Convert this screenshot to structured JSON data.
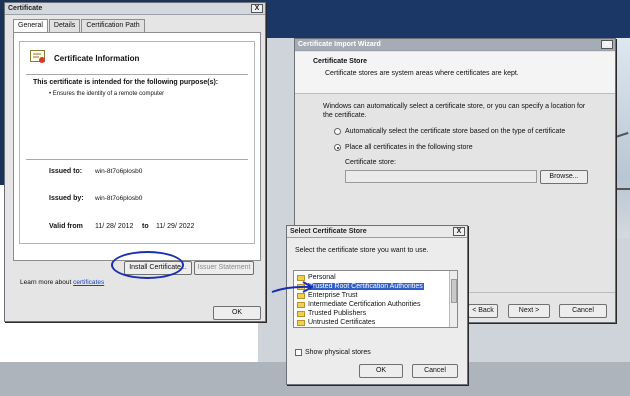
{
  "certificate_dialog": {
    "title": "Certificate",
    "tabs": [
      "General",
      "Details",
      "Certification Path"
    ],
    "info_heading": "Certificate Information",
    "purpose_heading": "This certificate is intended for the following purpose(s):",
    "purpose_item": "• Ensures the identity of a remote computer",
    "issued_to_label": "Issued to:",
    "issued_to_value": "win-8t7o6plosb0",
    "issued_by_label": "Issued by:",
    "issued_by_value": "win-8t7o6plosb0",
    "valid_from_label": "Valid from",
    "valid_from_value": "11/ 28/ 2012",
    "valid_to_label": "to",
    "valid_to_value": "11/ 29/ 2022",
    "install_button": "Install Certificate...",
    "issuer_button": "Issuer Statement",
    "learn_more_text": "Learn more about ",
    "learn_more_link": "certificates",
    "ok_button": "OK"
  },
  "import_wizard": {
    "title": "Certificate Import Wizard",
    "heading": "Certificate Store",
    "subheading": "Certificate stores are system areas where certificates are kept.",
    "description": "Windows can automatically select a certificate store, or you can specify a location for the certificate.",
    "option_auto": "Automatically select the certificate store based on the type of certificate",
    "option_place": "Place all certificates in the following store",
    "store_label": "Certificate store:",
    "store_value": "",
    "browse_button": "Browse...",
    "back_button": "< Back",
    "next_button": "Next >",
    "cancel_button": "Cancel",
    "selected_option": "place"
  },
  "select_store": {
    "title": "Select Certificate Store",
    "prompt": "Select the certificate store you want to use.",
    "items": [
      "Personal",
      "Trusted Root Certification Authorities",
      "Enterprise Trust",
      "Intermediate Certification Authorities",
      "Trusted Publishers",
      "Untrusted Certificates"
    ],
    "selected_item": "Trusted Root Certification Authorities",
    "show_physical_label": "Show physical stores",
    "show_physical_checked": false,
    "ok_button": "OK",
    "cancel_button": "Cancel"
  },
  "annotations": {
    "circle_color": "#1a2fb0",
    "arrow_color": "#1a2fb0"
  },
  "close_glyph": "X"
}
